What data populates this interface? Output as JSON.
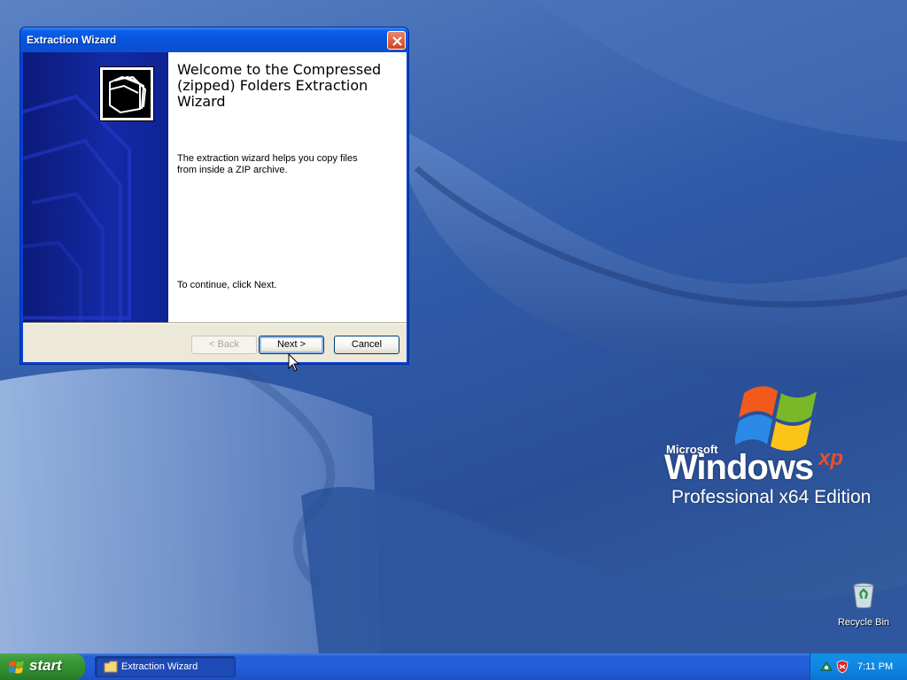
{
  "desktop": {
    "logo_brand": "Microsoft",
    "logo_windows": "Windows",
    "logo_xp": "xp",
    "logo_edition": "Professional x64 Edition",
    "recycle_bin_label": "Recycle Bin"
  },
  "wizard": {
    "title": "Extraction Wizard",
    "heading": "Welcome to the Compressed (zipped) Folders Extraction Wizard",
    "description": "The extraction wizard helps you copy files from inside a ZIP archive.",
    "continue_text": "To continue, click Next.",
    "back_label": "< Back",
    "next_label": "Next >",
    "cancel_label": "Cancel",
    "back_enabled": false
  },
  "taskbar": {
    "start_label": "start",
    "task_items": [
      "Extraction Wizard"
    ],
    "clock": "7:11 PM"
  },
  "icons": [
    "windows-flag-icon",
    "recycle-bin-icon",
    "close-icon",
    "folder-icon",
    "compressed-folder-icon",
    "tray-network-icon",
    "tray-security-icon",
    "mouse-cursor-icon"
  ],
  "colors": {
    "titlebar": "#0a5ee8",
    "banner": "#142aa6",
    "start_button": "#3d9b3b",
    "taskbar": "#245ddb",
    "tray": "#0f87e0"
  }
}
